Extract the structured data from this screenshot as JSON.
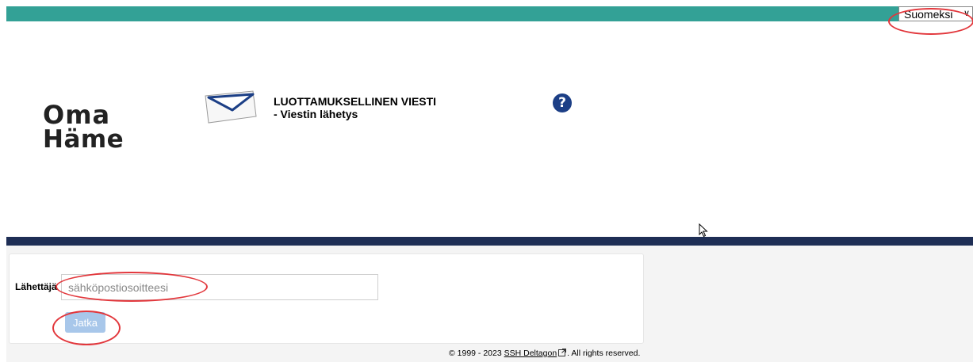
{
  "header": {
    "language": "Suomeksi",
    "logo_line1": "Oma",
    "logo_line2": "Häme",
    "title_line1": "LUOTTAMUKSELLINEN VIESTI",
    "title_line2": "- Viestin lähetys",
    "help_symbol": "?"
  },
  "form": {
    "sender_label": "Lähettäjä",
    "sender_placeholder": "sähköpostiosoitteesi",
    "sender_value": "",
    "continue_button": "Jatka"
  },
  "footer": {
    "copyright": "© 1999 - 2023",
    "company_link": "SSH Deltagon",
    "rights": ". All rights reserved."
  },
  "colors": {
    "topbar": "#33a196",
    "navbar": "#1e2e55",
    "help_icon": "#1c3f86",
    "button": "#a8c7ea",
    "highlight": "#e2373c"
  },
  "icons": {
    "envelope": "envelope-icon",
    "help": "help-icon",
    "external_link": "external-link-icon",
    "cursor": "mouse-cursor-icon",
    "language_chevron": "chevron-down-icon"
  }
}
